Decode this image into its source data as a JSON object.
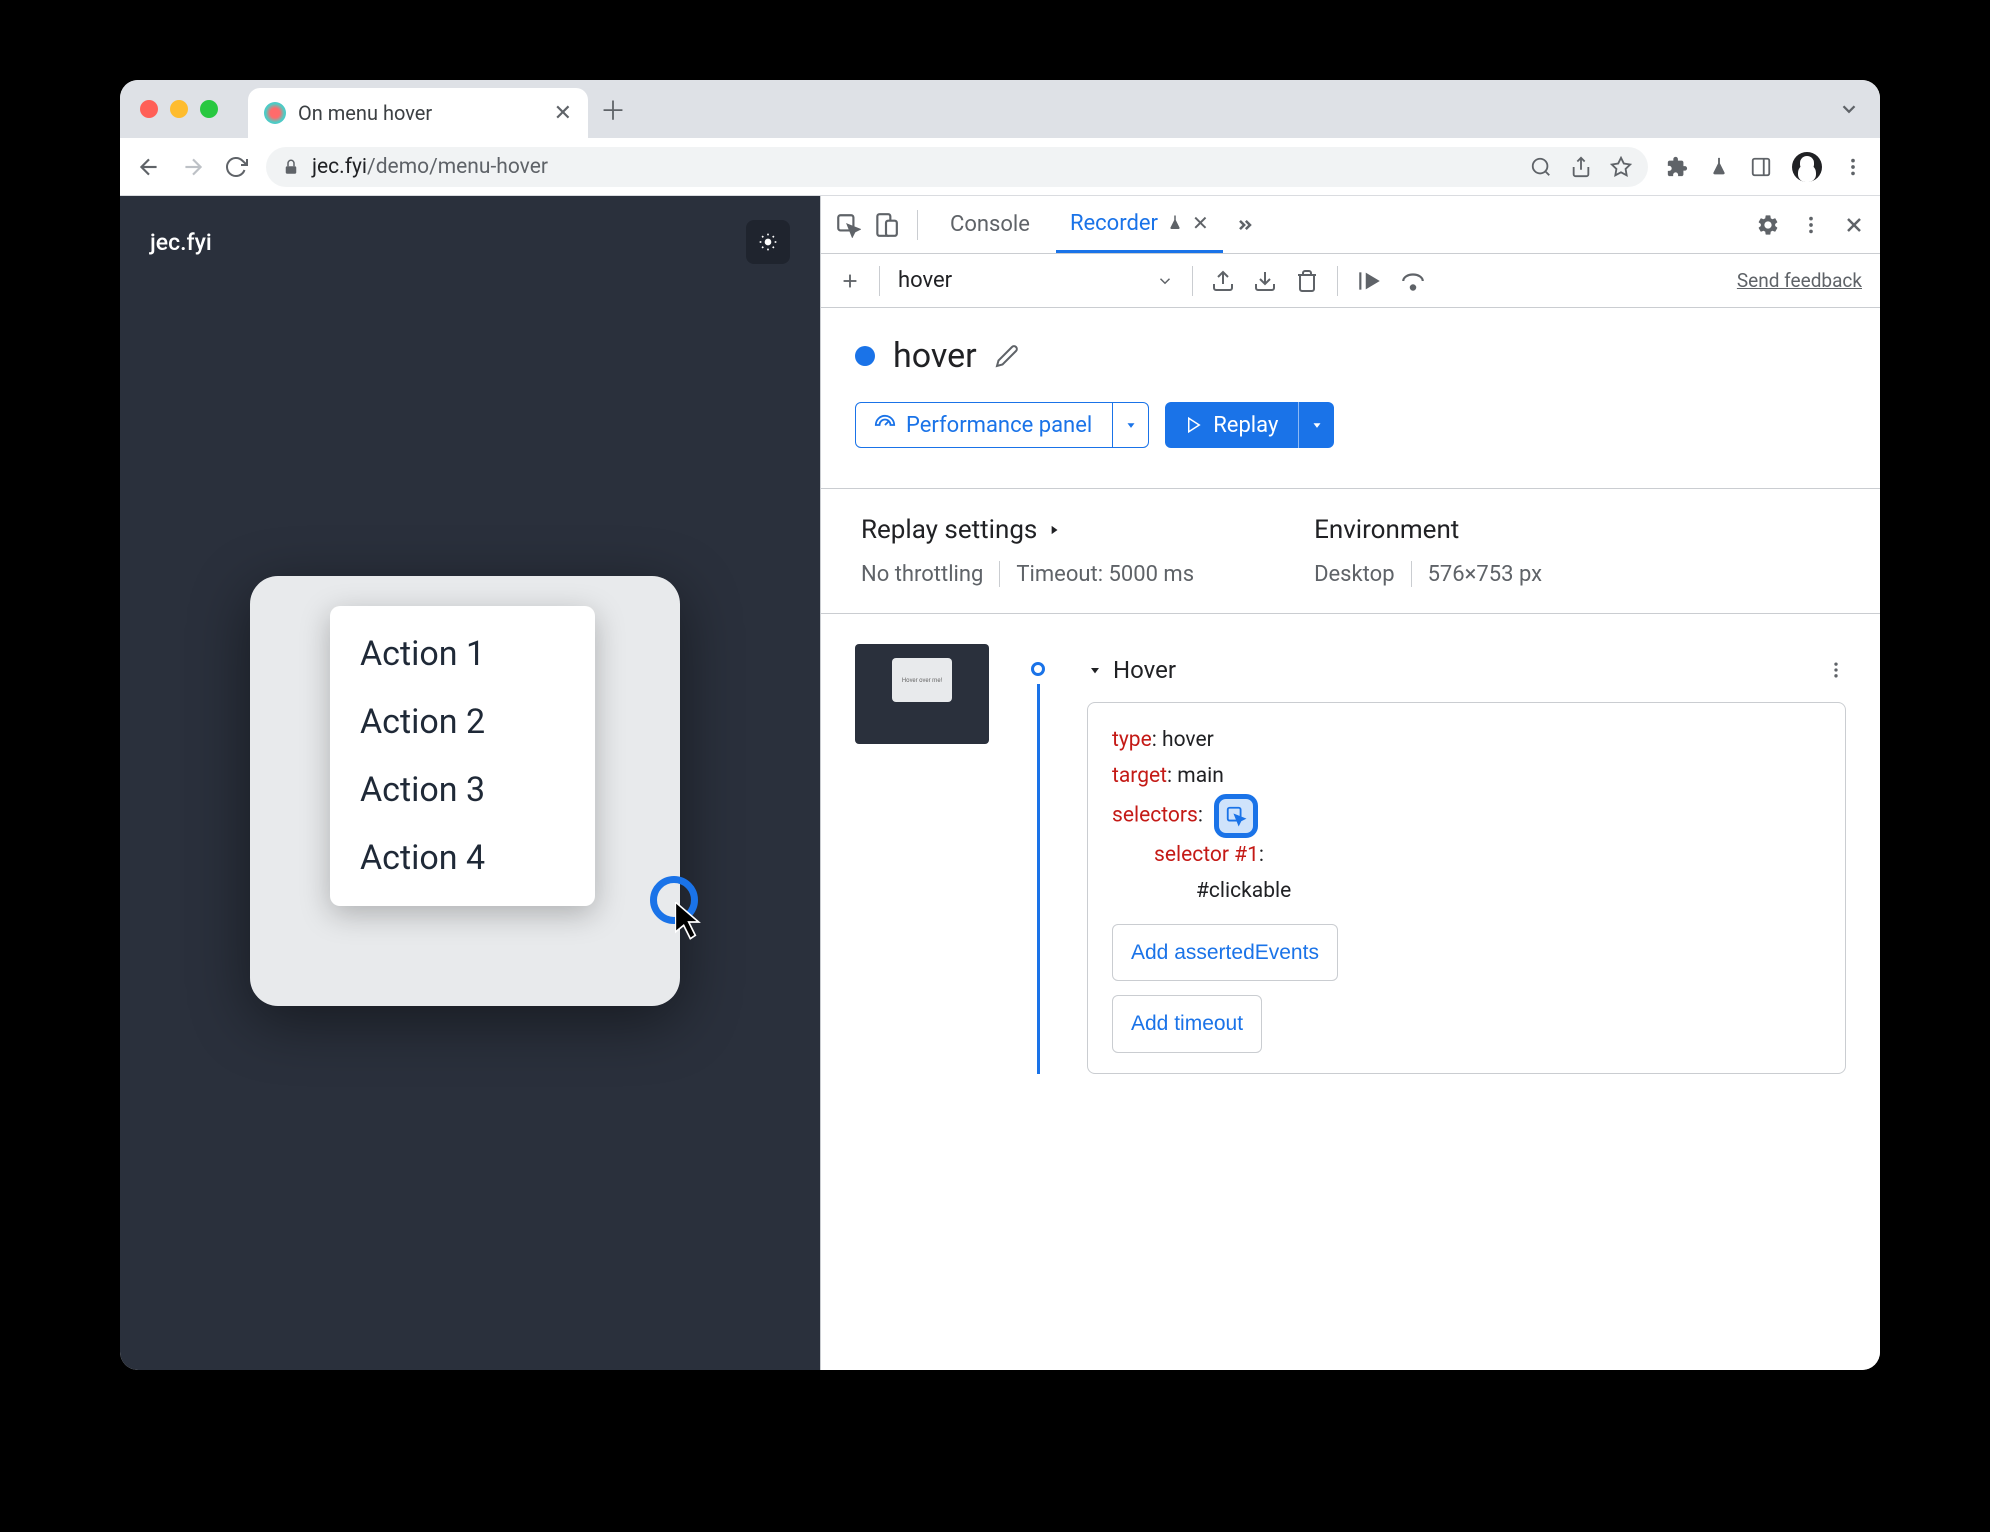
{
  "browser_tab": {
    "title": "On menu hover",
    "url_domain": "jec.fyi",
    "url_path": "/demo/menu-hover"
  },
  "page": {
    "brand": "jec.fyi",
    "card_text": "Hover over me!",
    "menu_items": [
      "Action 1",
      "Action 2",
      "Action 3",
      "Action 4"
    ]
  },
  "devtools": {
    "tabs": {
      "console": "Console",
      "recorder": "Recorder"
    },
    "subbar": {
      "recording_name": "hover",
      "feedback": "Send feedback"
    },
    "recording": {
      "title": "hover",
      "perf_button": "Performance panel",
      "replay_button": "Replay"
    },
    "settings": {
      "replay_heading": "Replay settings",
      "throttling": "No throttling",
      "timeout": "Timeout: 5000 ms",
      "env_heading": "Environment",
      "device": "Desktop",
      "viewport": "576×753 px"
    },
    "step": {
      "name": "Hover",
      "type_key": "type",
      "type_val": ": hover",
      "target_key": "target",
      "target_val": ": main",
      "selectors_key": "selectors",
      "selectors_val": ":",
      "sel_num_key": "selector #1",
      "sel_num_val": ":",
      "sel_value": "#clickable",
      "add_asserted": "Add assertedEvents",
      "add_timeout": "Add timeout"
    },
    "thumb_text": "Hover over me!"
  }
}
